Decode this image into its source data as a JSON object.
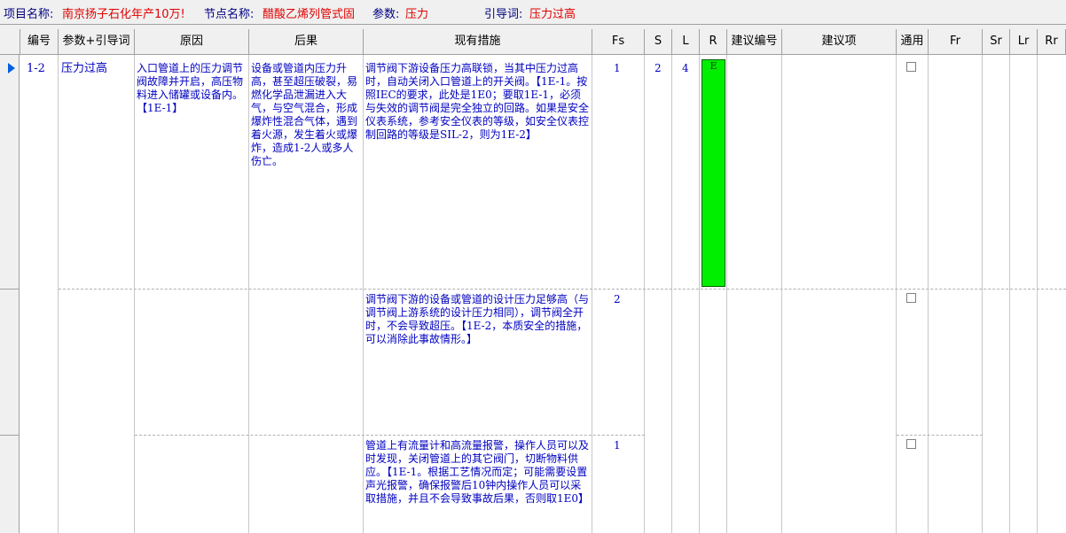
{
  "topbar": {
    "project_label": "项目名称:",
    "project_value": "南京扬子石化年产10万!",
    "node_label": "节点名称:",
    "node_value": "醋酸乙烯列管式固",
    "param_label": "参数:",
    "param_value": "压力",
    "guide_label": "引导词:",
    "guide_value": "压力过高"
  },
  "columns": {
    "no": "编号",
    "param": "参数+引导词",
    "cause": "原因",
    "consequence": "后果",
    "measures": "现有措施",
    "fs": "Fs",
    "s": "S",
    "l": "L",
    "r": "R",
    "sugg_no": "建议编号",
    "suggestion": "建议项",
    "common": "通用",
    "fr": "Fr",
    "sr": "Sr",
    "lr": "Lr",
    "rr": "Rr"
  },
  "record": {
    "no": "1-2",
    "param": "压力过高",
    "cause": "入口管道上的压力调节阀故障并开启，高压物料进入储罐或设备内。【1E-1】",
    "consequence": "设备或管道内压力升高，甚至超压破裂，易燃化学品泄漏进入大气，与空气混合，形成爆炸性混合气体，遇到着火源，发生着火或爆炸，造成1-2人或多人伤亡。",
    "s": "2",
    "l": "4",
    "r": "E",
    "r_color": "#00ee00"
  },
  "measures": [
    {
      "text": "调节阀下游设备压力高联锁，当其中压力过高时，自动关闭入口管道上的开关阀。【1E-1。按照IEC的要求，此处是1E0；要取1E-1，必须与失效的调节阀是完全独立的回路。如果是安全仪表系统，参考安全仪表的等级，如安全仪表控制回路的等级是SIL-2，则为1E-2】",
      "fs": "1",
      "common": false
    },
    {
      "text": "调节阀下游的设备或管道的设计压力足够高（与调节阀上游系统的设计压力相同），调节阀全开时，不会导致超压。【1E-2，本质安全的措施，可以消除此事故情形。】",
      "fs": "2",
      "common": false
    },
    {
      "text": "管道上有流量计和高流量报警，操作人员可以及时发现，关闭管道上的其它阀门，切断物料供应。【1E-1。根据工艺情况而定；可能需要设置声光报警，确保报警后10钟内操作人员可以采取措施，并且不会导致事故后果，否则取1E0】",
      "fs": "1",
      "common": false
    }
  ]
}
